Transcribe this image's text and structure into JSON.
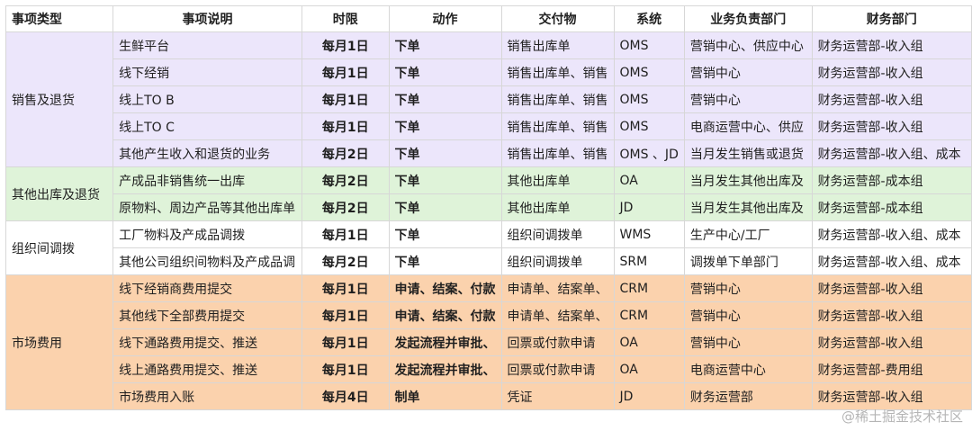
{
  "headers": [
    "事项类型",
    "事项说明",
    "时限",
    "动作",
    "交付物",
    "系统",
    "业务负责部门",
    "财务部门"
  ],
  "groups": [
    {
      "type": "销售及退货",
      "class": "g-sales",
      "rows": [
        [
          "生鲜平台",
          "每月1日",
          "下单",
          "销售出库单",
          "OMS",
          "营销中心、供应中心",
          "财务运营部-收入组"
        ],
        [
          "线下经销",
          "每月1日",
          "下单",
          "销售出库单、销售",
          "OMS",
          "营销中心",
          "财务运营部-收入组"
        ],
        [
          "线上TO B",
          "每月1日",
          "下单",
          "销售出库单、销售",
          "OMS",
          "营销中心",
          "财务运营部-收入组"
        ],
        [
          "线上TO C",
          "每月1日",
          "下单",
          "销售出库单、销售",
          "OMS",
          "电商运营中心、供应",
          "财务运营部-收入组"
        ],
        [
          "其他产生收入和退货的业务",
          "每月2日",
          "下单",
          "销售出库单、销售",
          "OMS 、JD",
          "当月发生销售或退货",
          "财务运营部-收入组、成本"
        ]
      ]
    },
    {
      "type": "其他出库及退货",
      "class": "g-other",
      "rows": [
        [
          "产成品非销售统一出库",
          "每月2日",
          "下单",
          "其他出库单",
          "OA",
          "当月发生其他出库及",
          "财务运营部-成本组"
        ],
        [
          "原物料、周边产品等其他出库单",
          "每月2日",
          "下单",
          "其他出库单",
          "JD",
          "当月发生其他出库及",
          "财务运营部-成本组"
        ]
      ]
    },
    {
      "type": "组织间调拨",
      "class": "g-org",
      "rows": [
        [
          "工厂物料及产成品调拨",
          "每月1日",
          "下单",
          "组织间调拨单",
          "WMS",
          "生产中心/工厂",
          "财务运营部-收入组、成本"
        ],
        [
          "其他公司组织间物料及产成品调",
          "每月2日",
          "下单",
          "组织间调拨单",
          "SRM",
          "调拨单下单部门",
          "财务运营部-收入组、成本"
        ]
      ]
    },
    {
      "type": "市场费用",
      "class": "g-market",
      "rows": [
        [
          "线下经销商费用提交",
          "每月1日",
          "申请、结案、付款",
          "申请单、结案单、",
          "CRM",
          "营销中心",
          "财务运营部-收入组"
        ],
        [
          "其他线下全部费用提交",
          "每月1日",
          "申请、结案、付款",
          "申请单、结案单、",
          "CRM",
          "营销中心",
          "财务运营部-收入组"
        ],
        [
          "线下通路费用提交、推送",
          "每月1日",
          "发起流程并审批、",
          "回票或付款申请",
          "OA",
          "营销中心",
          "财务运营部-收入组"
        ],
        [
          "线上通路费用提交、推送",
          "每月1日",
          "发起流程并审批、",
          "回票或付款申请",
          "OA",
          "电商运营中心",
          "财务运营部-费用组"
        ],
        [
          "市场费用入账",
          "每月4日",
          "制单",
          "凭证",
          "JD",
          "财务运营部",
          "财务运营部-收入组"
        ]
      ]
    }
  ],
  "watermark": "@稀土掘金技术社区"
}
